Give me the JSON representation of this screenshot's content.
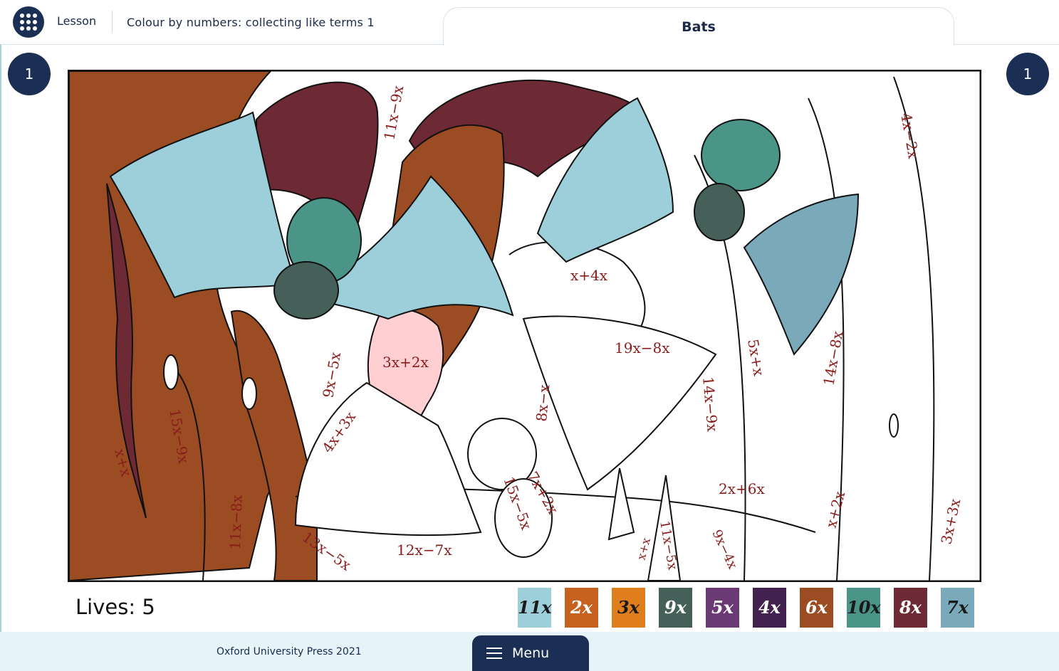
{
  "header": {
    "lesson_label": "Lesson",
    "lesson_title": "Colour by numbers: collecting like terms 1",
    "tab_title": "Bats"
  },
  "counters": {
    "left": "1",
    "right": "1"
  },
  "status": {
    "lives": "Lives: 5"
  },
  "palette": [
    {
      "label": "11x",
      "color": "#9ccfda",
      "text_color": "#1a1a1a"
    },
    {
      "label": "2x",
      "color": "#c6611f",
      "text_color": "#ffffff"
    },
    {
      "label": "3x",
      "color": "#e07e1e",
      "text_color": "#1a1a1a"
    },
    {
      "label": "9x",
      "color": "#456058",
      "text_color": "#ffffff"
    },
    {
      "label": "5x",
      "color": "#6b3a74",
      "text_color": "#ffffff"
    },
    {
      "label": "4x",
      "color": "#42214f",
      "text_color": "#ffffff"
    },
    {
      "label": "6x",
      "color": "#9b4c22",
      "text_color": "#ffffff"
    },
    {
      "label": "10x",
      "color": "#4a9488",
      "text_color": "#1a1a1a"
    },
    {
      "label": "8x",
      "color": "#6d2934",
      "text_color": "#ffffff"
    },
    {
      "label": "7x",
      "color": "#7aa9b9",
      "text_color": "#1a1a1a"
    }
  ],
  "picture": {
    "expressions": [
      "11x−9x",
      "4x−2x",
      "x+4x",
      "19x−8x",
      "3x+2x",
      "9x−5x",
      "14x−9x",
      "5x+x",
      "14x−8x",
      "8x−x",
      "4x+3x",
      "15x−9x",
      "x+x",
      "11x−8x",
      "2x+6x",
      "x+2x",
      "3x+3x",
      "15x−5x",
      "7x+2x",
      "12x−7x",
      "13x−5x",
      "11x−5x",
      "9x−4x",
      "x+x"
    ]
  },
  "footer": {
    "copyright": "Oxford University Press 2021",
    "menu_label": "Menu"
  },
  "colors": {
    "navy": "#1b2f55",
    "expression_red": "#8a1c1c",
    "footer_bg": "#e6f4f9"
  }
}
